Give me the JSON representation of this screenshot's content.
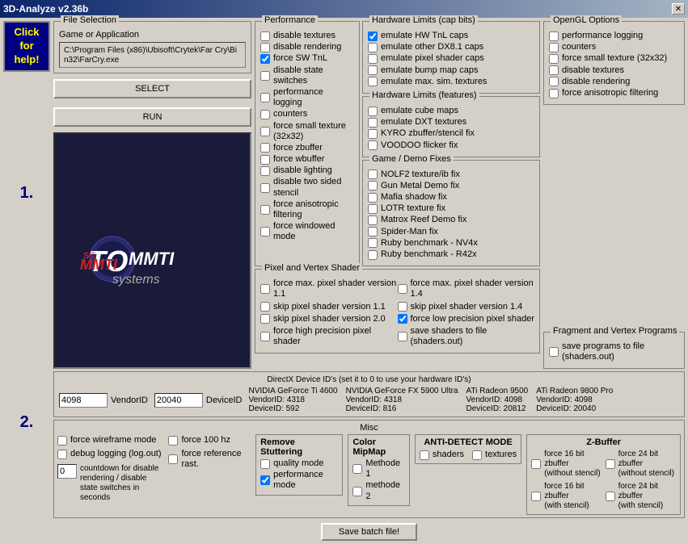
{
  "window": {
    "title": "3D-Analyze v2.36b",
    "close_label": "✕"
  },
  "left": {
    "click_help": "Click\nfor\nhelp!",
    "step1": "1.",
    "step2": "2.",
    "select_label": "SELECT",
    "run_label": "RUN",
    "logo_line1": "TOMMTI",
    "logo_line2": "systems"
  },
  "file_selection": {
    "label": "File Selection",
    "path": "C:\\Program Files (x86)\\Ubisoft\\Crytek\\Far Cry\\Bin32\\FarCry.exe",
    "section_label": "Game or Application"
  },
  "performance": {
    "label": "Performance",
    "options": [
      {
        "label": "disable textures",
        "checked": false
      },
      {
        "label": "disable rendering",
        "checked": false
      },
      {
        "label": "force SW TnL",
        "checked": true
      },
      {
        "label": "disable state switches",
        "checked": false
      },
      {
        "label": "performance logging",
        "checked": false
      },
      {
        "label": "counters",
        "checked": false
      },
      {
        "label": "force small texture (32x32)",
        "checked": false
      },
      {
        "label": "force zbuffer",
        "checked": false
      },
      {
        "label": "force wbuffer",
        "checked": false
      },
      {
        "label": "disable lighting",
        "checked": false
      },
      {
        "label": "disable two sided stencil",
        "checked": false
      },
      {
        "label": "force anisotropic filtering",
        "checked": false
      },
      {
        "label": "force windowed mode",
        "checked": false
      }
    ]
  },
  "pixel_vertex": {
    "label": "Pixel and Vertex Shader",
    "options": [
      {
        "label": "force max. pixel shader version 1.1",
        "checked": false
      },
      {
        "label": "force max. pixel shader version 1.4",
        "checked": false
      },
      {
        "label": "skip pixel shader version 1.1",
        "checked": false
      },
      {
        "label": "skip pixel shader version 1.4",
        "checked": false
      },
      {
        "label": "skip pixel shader version 2.0",
        "checked": false
      },
      {
        "label": "force low precision pixel shader",
        "checked": true
      },
      {
        "label": "force high precision pixel shader",
        "checked": false
      },
      {
        "label": "save shaders to file (shaders.out)",
        "checked": false
      }
    ]
  },
  "hardware_limits_cap": {
    "label": "Hardware Limits (cap bits)",
    "options": [
      {
        "label": "emulate HW TnL caps",
        "checked": true
      },
      {
        "label": "emulate other DX8.1 caps",
        "checked": false
      },
      {
        "label": "emulate pixel shader caps",
        "checked": false
      },
      {
        "label": "emulate bump map caps",
        "checked": false
      },
      {
        "label": "emulate max. sim. textures",
        "checked": false
      }
    ]
  },
  "hardware_limits_feat": {
    "label": "Hardware Limits (features)",
    "options": [
      {
        "label": "emulate cube maps",
        "checked": false
      },
      {
        "label": "emulate DXT textures",
        "checked": false
      },
      {
        "label": "KYRO zbuffer/stencil fix",
        "checked": false
      },
      {
        "label": "VOODOO flicker fix",
        "checked": false
      }
    ]
  },
  "game_demo_fixes": {
    "label": "Game / Demo Fixes",
    "options": [
      {
        "label": "NOLF2 texture/ib fix",
        "checked": false
      },
      {
        "label": "Gun Metal Demo fix",
        "checked": false
      },
      {
        "label": "Mafia shadow fix",
        "checked": false
      },
      {
        "label": "LOTR texture fix",
        "checked": false
      },
      {
        "label": "Matrox Reef Demo fix",
        "checked": false
      },
      {
        "label": "Spider-Man fix",
        "checked": false
      },
      {
        "label": "Ruby benchmark - NV4x",
        "checked": false
      },
      {
        "label": "Ruby benchmark - R42x",
        "checked": false
      }
    ]
  },
  "opengl": {
    "label": "OpenGL Options",
    "options": [
      {
        "label": "performance logging",
        "checked": false
      },
      {
        "label": "counters",
        "checked": false
      },
      {
        "label": "force small texture (32x32)",
        "checked": false
      },
      {
        "label": "disable textures",
        "checked": false
      },
      {
        "label": "disable rendering",
        "checked": false
      },
      {
        "label": "force anisotropic filtering",
        "checked": false
      }
    ]
  },
  "fragment": {
    "label": "Fragment and Vertex Programs",
    "options": [
      {
        "label": "save programs to file (shaders.out)",
        "checked": false
      }
    ]
  },
  "directx_ids": {
    "label": "DirectX Device ID's (set it to 0 to use your hardware ID's)",
    "vendor_id_label": "VendorID",
    "device_id_label": "DeviceID",
    "vendor_id_value": "4098",
    "device_id_value": "20040",
    "cards": [
      {
        "name": "NVIDIA GeForce Ti 4600",
        "vendor": "VendorID: 4318",
        "device": "DeviceID: 592"
      },
      {
        "name": "NVIDIA GeForce FX 5900 Ultra",
        "vendor": "VendorID: 4318",
        "device": "DeviceID: 816"
      },
      {
        "name": "ATi Radeon 9500",
        "vendor": "VendorID: 4098",
        "device": "DeviceID: 20812"
      },
      {
        "name": "ATi Radeon 9800 Pro",
        "vendor": "VendorID: 4098",
        "device": "DeviceID: 20040"
      }
    ]
  },
  "misc": {
    "label": "Misc",
    "options": [
      {
        "label": "force wireframe mode",
        "checked": false
      },
      {
        "label": "debug logging (log.out)",
        "checked": false
      },
      {
        "label": "force 100 hz",
        "checked": false
      },
      {
        "label": "force reference rast.",
        "checked": false
      }
    ],
    "countdown_label": "countdown for disable rendering / disable state switches in seconds",
    "countdown_value": "0",
    "remove_stuttering_label": "Remove Stuttering",
    "quality_mode_label": "quality mode",
    "performance_mode_label": "performance mode",
    "quality_checked": false,
    "performance_checked": true
  },
  "color_mipmap": {
    "label": "Color MipMap",
    "methode1_label": "Methode 1",
    "methode2_label": "methode 2",
    "methode1_checked": false,
    "methode2_checked": false
  },
  "anti_detect": {
    "label": "ANTI-DETECT MODE",
    "shaders_label": "shaders",
    "textures_label": "textures",
    "shaders_checked": false,
    "textures_checked": false
  },
  "zbuffer": {
    "label": "Z-Buffer",
    "options": [
      {
        "label": "force 24 bit zbuffer (without stencil)",
        "checked": false
      },
      {
        "label": "force 16 bit zbuffer (with stencil)",
        "checked": false
      },
      {
        "label": "force 24 bit zbuffer (with stencil)",
        "checked": false
      }
    ]
  },
  "zbuffer_left": {
    "options": [
      {
        "label": "force 16 bit zbuffer (without stencil)",
        "checked": false
      },
      {
        "label": "force 16 bit zbuffer (with stencil)",
        "checked": false
      }
    ]
  },
  "save_batch": {
    "label": "Save batch file!"
  }
}
